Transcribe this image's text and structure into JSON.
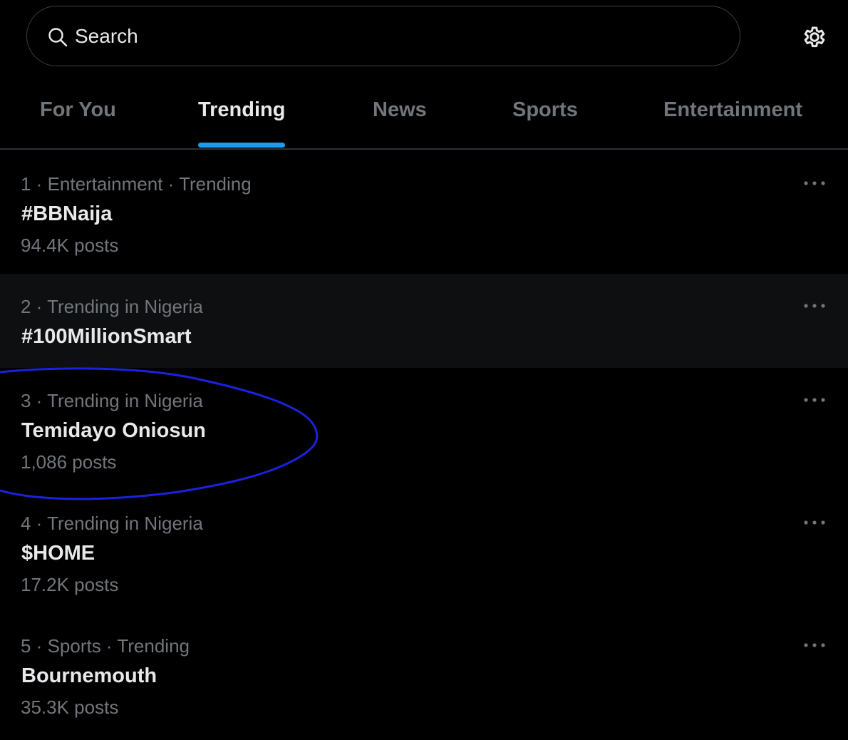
{
  "search": {
    "placeholder": "Search",
    "value": ""
  },
  "icons": {
    "search": "search-icon",
    "settings": "gear-icon",
    "more": "more-options-icon"
  },
  "colors": {
    "background": "#000000",
    "accent": "#1d9bf0",
    "primary_text": "#e7e9ea",
    "secondary_text": "#71767b",
    "annotation_stroke": "#1a22e0"
  },
  "tabs": [
    {
      "label": "For You",
      "active": false
    },
    {
      "label": "Trending",
      "active": true
    },
    {
      "label": "News",
      "active": false
    },
    {
      "label": "Sports",
      "active": false
    },
    {
      "label": "Entertainment",
      "active": false
    }
  ],
  "trends": [
    {
      "context": "1 · Entertainment · Trending",
      "name": "#BBNaija",
      "posts": "94.4K posts"
    },
    {
      "context": "2 · Trending in Nigeria",
      "name": "#100MillionSmart",
      "posts": ""
    },
    {
      "context": "3 · Trending in Nigeria",
      "name": "Temidayo Oniosun",
      "posts": "1,086 posts"
    },
    {
      "context": "4 · Trending in Nigeria",
      "name": "$HOME",
      "posts": "17.2K posts"
    },
    {
      "context": "5 · Sports · Trending",
      "name": "Bournemouth",
      "posts": "35.3K posts"
    }
  ]
}
